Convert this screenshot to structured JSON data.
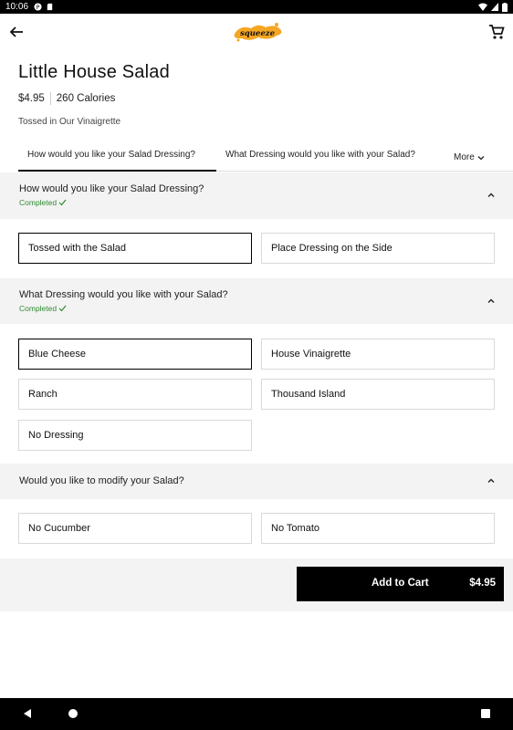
{
  "status_bar": {
    "time": "10:06"
  },
  "header": {
    "logo_text": "squeeze"
  },
  "item": {
    "name": "Little House Salad",
    "price": "$4.95",
    "calories": "260 Calories",
    "description": "Tossed in Our Vinaigrette"
  },
  "tabs": [
    {
      "label": "How would you like your Salad Dressing?",
      "active": true
    },
    {
      "label": "What Dressing would you like with your Salad?",
      "active": false
    },
    {
      "label": "More",
      "active": false
    }
  ],
  "sections": [
    {
      "question": "How would you like your Salad Dressing?",
      "status": "Completed",
      "options": [
        {
          "label": "Tossed with the Salad",
          "selected": true
        },
        {
          "label": "Place Dressing on the Side",
          "selected": false
        }
      ]
    },
    {
      "question": "What Dressing would you like with your Salad?",
      "status": "Completed",
      "options": [
        {
          "label": "Blue Cheese",
          "selected": true
        },
        {
          "label": "House Vinaigrette",
          "selected": false
        },
        {
          "label": "Ranch",
          "selected": false
        },
        {
          "label": "Thousand Island",
          "selected": false
        },
        {
          "label": "No Dressing",
          "selected": false
        }
      ]
    },
    {
      "question": "Would you like to modify your Salad?",
      "status": "",
      "options": [
        {
          "label": "No Cucumber",
          "selected": false
        },
        {
          "label": "No Tomato",
          "selected": false
        }
      ]
    }
  ],
  "cart_button": {
    "label": "Add to Cart",
    "price": "$4.95"
  },
  "colors": {
    "completed": "#2e8b30",
    "accent": "#000000",
    "logo": "#f5a623"
  }
}
